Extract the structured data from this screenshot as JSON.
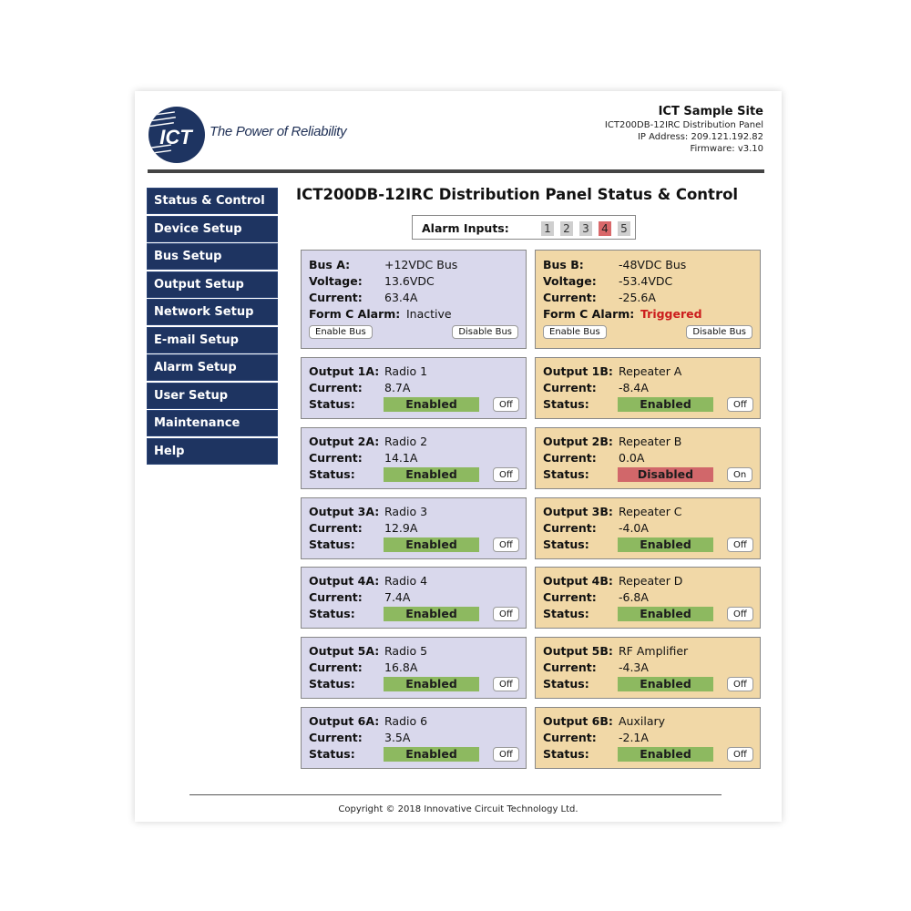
{
  "header": {
    "logo_text": "ICT",
    "tagline": "The Power of Reliability",
    "site_name": "ICT Sample Site",
    "device": "ICT200DB-12IRC Distribution Panel",
    "ip": "IP Address: 209.121.192.82",
    "firmware": "Firmware: v3.10"
  },
  "nav": [
    "Status & Control",
    "Device Setup",
    "Bus Setup",
    "Output Setup",
    "Network Setup",
    "E-mail Setup",
    "Alarm Setup",
    "User Setup",
    "Maintenance",
    "Help"
  ],
  "page_title": "ICT200DB-12IRC Distribution Panel Status & Control",
  "alarm": {
    "label": "Alarm Inputs:",
    "inputs": [
      {
        "num": "1",
        "active": false
      },
      {
        "num": "2",
        "active": false
      },
      {
        "num": "3",
        "active": false
      },
      {
        "num": "4",
        "active": true
      },
      {
        "num": "5",
        "active": false
      }
    ]
  },
  "labels": {
    "voltage": "Voltage:",
    "current": "Current:",
    "form_c": "Form C Alarm:",
    "status": "Status:",
    "enable_bus": "Enable Bus",
    "disable_bus": "Disable Bus"
  },
  "buses": [
    {
      "label": "Bus A:",
      "name": "+12VDC Bus",
      "voltage": "13.6VDC",
      "current": "63.4A",
      "alarm": "Inactive",
      "alarm_triggered": false
    },
    {
      "label": "Bus B:",
      "name": "-48VDC Bus",
      "voltage": "-53.4VDC",
      "current": "-25.6A",
      "alarm": "Triggered",
      "alarm_triggered": true
    }
  ],
  "outputs_a": [
    {
      "label": "Output 1A:",
      "name": "Radio 1",
      "current": "8.7A",
      "status": "Enabled",
      "button": "Off"
    },
    {
      "label": "Output 2A:",
      "name": "Radio 2",
      "current": "14.1A",
      "status": "Enabled",
      "button": "Off"
    },
    {
      "label": "Output 3A:",
      "name": "Radio 3",
      "current": "12.9A",
      "status": "Enabled",
      "button": "Off"
    },
    {
      "label": "Output 4A:",
      "name": "Radio 4",
      "current": "7.4A",
      "status": "Enabled",
      "button": "Off"
    },
    {
      "label": "Output 5A:",
      "name": "Radio 5",
      "current": "16.8A",
      "status": "Enabled",
      "button": "Off"
    },
    {
      "label": "Output 6A:",
      "name": "Radio 6",
      "current": "3.5A",
      "status": "Enabled",
      "button": "Off"
    }
  ],
  "outputs_b": [
    {
      "label": "Output 1B:",
      "name": "Repeater A",
      "current": "-8.4A",
      "status": "Enabled",
      "button": "Off"
    },
    {
      "label": "Output 2B:",
      "name": "Repeater B",
      "current": "0.0A",
      "status": "Disabled",
      "button": "On"
    },
    {
      "label": "Output 3B:",
      "name": "Repeater C",
      "current": "-4.0A",
      "status": "Enabled",
      "button": "Off"
    },
    {
      "label": "Output 4B:",
      "name": "Repeater D",
      "current": "-6.8A",
      "status": "Enabled",
      "button": "Off"
    },
    {
      "label": "Output 5B:",
      "name": "RF Amplifier",
      "current": "-4.3A",
      "status": "Enabled",
      "button": "Off"
    },
    {
      "label": "Output 6B:",
      "name": "Auxilary",
      "current": "-2.1A",
      "status": "Enabled",
      "button": "Off"
    }
  ],
  "colors": {
    "nav_bg": "#1e3461",
    "bus_a_bg": "#d9d8ec",
    "bus_b_bg": "#f1d8a7",
    "status_enabled": "#8db960",
    "status_disabled": "#d1676a",
    "alarm_active": "#d9686a",
    "triggered_text": "#cc1d1d"
  },
  "footer": "Copyright © 2018 Innovative Circuit Technology Ltd."
}
